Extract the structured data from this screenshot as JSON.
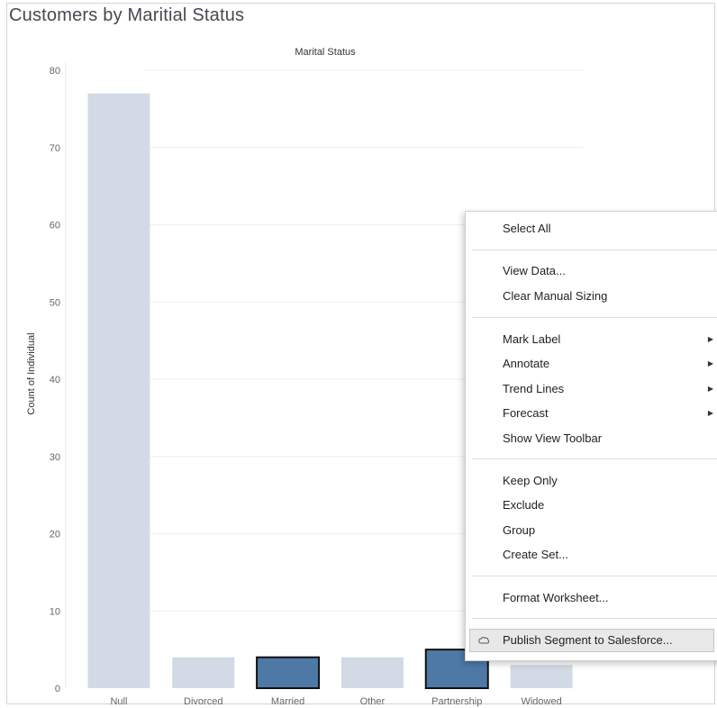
{
  "sheet": {
    "title": "Customers by Maritial Status"
  },
  "chart_data": {
    "type": "bar",
    "title": "Customers by Maritial Status",
    "header_label": "Marital Status",
    "xlabel": "",
    "ylabel": "Count of Individual",
    "categories": [
      "Null",
      "Divorced",
      "Married",
      "Other",
      "Partnership",
      "Widowed"
    ],
    "values": [
      77,
      4,
      4,
      4,
      5,
      3
    ],
    "selected": [
      false,
      false,
      true,
      false,
      true,
      false
    ],
    "ylim": [
      0,
      80
    ],
    "yticks": [
      0,
      10,
      20,
      30,
      40,
      50,
      60,
      70,
      80
    ],
    "grid": true,
    "colors": {
      "bar": "#d2dae5",
      "selected_bar": "#4e79a7",
      "selected_outline": "#111111",
      "grid": "#efefef"
    }
  },
  "context_menu": {
    "select_all": "Select All",
    "view_data": "View Data...",
    "clear_manual_sizing": "Clear Manual Sizing",
    "mark_label": "Mark Label",
    "annotate": "Annotate",
    "trend_lines": "Trend Lines",
    "forecast": "Forecast",
    "show_view_toolbar": "Show View Toolbar",
    "keep_only": "Keep Only",
    "exclude": "Exclude",
    "group": "Group",
    "create_set": "Create Set...",
    "format_worksheet": "Format Worksheet...",
    "publish_segment": "Publish Segment to Salesforce...",
    "publish_icon": "salesforce-cloud-icon",
    "submenu_icon": "submenu-arrow-icon"
  }
}
